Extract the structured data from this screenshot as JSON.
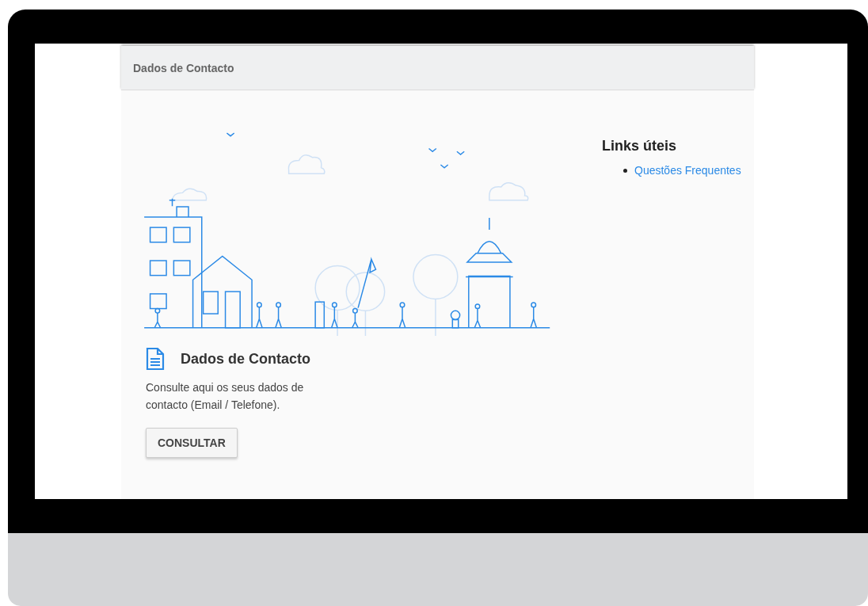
{
  "header": {
    "title": "Dados de Contacto"
  },
  "card": {
    "title": "Dados de Contacto",
    "description": "Consulte aqui os seus dados de contacto (Email / Telefone).",
    "button": "CONSULTAR"
  },
  "links": {
    "heading": "Links úteis",
    "items": [
      "Questões Frequentes"
    ]
  }
}
